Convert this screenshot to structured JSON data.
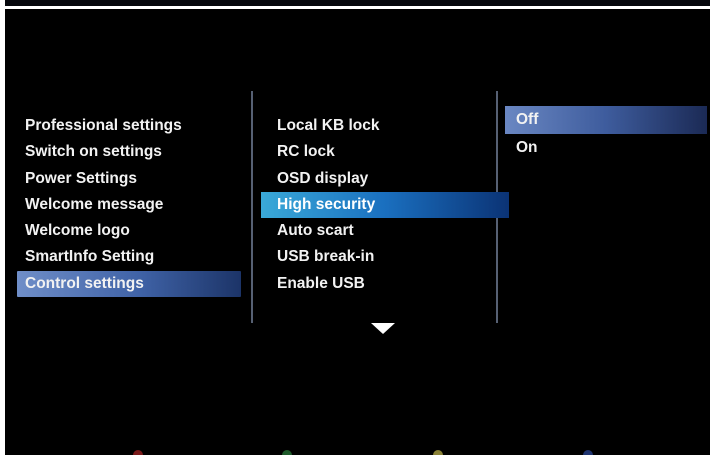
{
  "menu_left": {
    "items": [
      {
        "label": "Professional settings"
      },
      {
        "label": "Switch on settings"
      },
      {
        "label": "Power Settings"
      },
      {
        "label": "Welcome message"
      },
      {
        "label": "Welcome logo"
      },
      {
        "label": "SmartInfo Setting"
      },
      {
        "label": "Control settings"
      }
    ],
    "selected": "Control settings"
  },
  "menu_middle": {
    "items": [
      {
        "label": "Local KB lock"
      },
      {
        "label": "RC lock"
      },
      {
        "label": "OSD display"
      },
      {
        "label": "High security"
      },
      {
        "label": "Auto scart"
      },
      {
        "label": "USB break-in"
      },
      {
        "label": "Enable USB"
      }
    ],
    "selected": "High security"
  },
  "menu_right": {
    "items": [
      {
        "label": "Off"
      },
      {
        "label": "On"
      }
    ],
    "selected": "Off"
  },
  "icons": {
    "more_indicator": "chevron-down-icon"
  },
  "colors": {
    "background": "#000000",
    "text": "#f2f2f2",
    "left_highlight": "#5a7bbd",
    "middle_highlight": "#2a8fd0",
    "right_highlight": "#4a6aaa",
    "color_key_red": "#7a1a1a",
    "color_key_green": "#1e5a2a",
    "color_key_yellow": "#8a8236",
    "color_key_blue": "#1f3470"
  }
}
